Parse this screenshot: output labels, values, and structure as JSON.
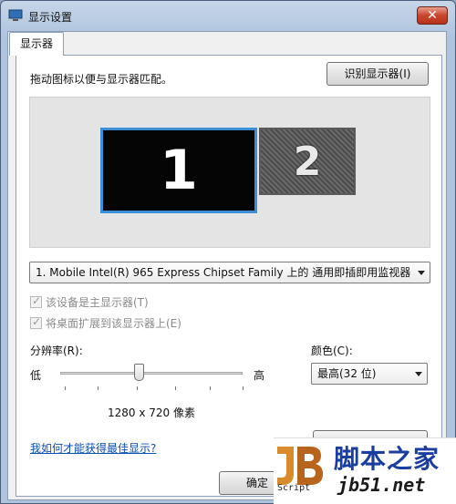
{
  "window": {
    "title": "显示设置",
    "close_label": "✕"
  },
  "tabs": [
    {
      "label": "显示器",
      "selected": true
    }
  ],
  "main": {
    "instruction": "拖动图标以便与显示器匹配。",
    "identify_button": "识别显示器(I)",
    "monitors": [
      {
        "number": "1",
        "selected": true
      },
      {
        "number": "2",
        "selected": false
      }
    ],
    "display_select": {
      "value": "1. Mobile Intel(R) 965 Express Chipset Family 上的 通用即插即用监视器"
    },
    "checkbox_primary": {
      "label": "该设备是主显示器(T)",
      "checked": true,
      "disabled": true
    },
    "checkbox_extend": {
      "label": "将桌面扩展到该显示器上(E)",
      "checked": true,
      "disabled": true
    },
    "resolution": {
      "label": "分辨率(R):",
      "low_label": "低",
      "high_label": "高",
      "value_text": "1280 x 720 像素",
      "slider_fraction": 0.43
    },
    "colors": {
      "label": "颜色(C):",
      "value": "最高(32 位)"
    },
    "help_link": "我如何才能获得最佳显示?",
    "ok_button": "确定"
  },
  "watermark": {
    "script_text": "Script",
    "brand_text": "脚本之家",
    "url_text": "jb51.net"
  },
  "colors": {
    "accent": "#3a8fd6",
    "link": "#0b4fb3",
    "close": "#c9452c"
  }
}
